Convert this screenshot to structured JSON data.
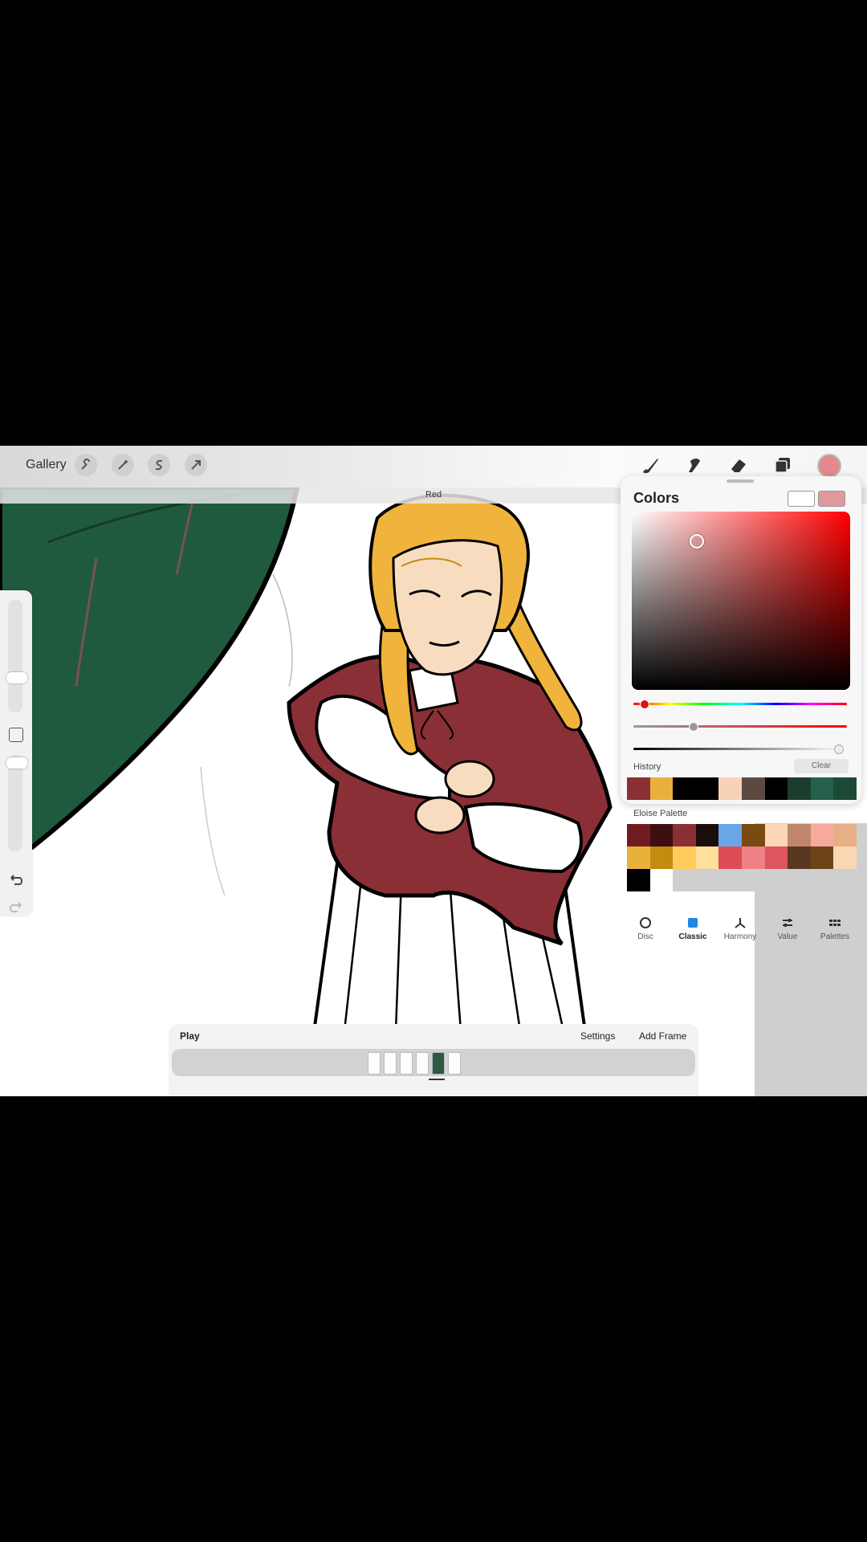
{
  "toolbar": {
    "gallery_label": "Gallery",
    "left_tools": [
      "wrench-icon",
      "magic-wand-icon",
      "selection-icon",
      "transform-arrow-icon"
    ],
    "right_tools": [
      "brush-icon",
      "smudge-icon",
      "eraser-icon",
      "layers-icon"
    ],
    "current_color": "#e28a8e"
  },
  "layer": {
    "name": "Red"
  },
  "colors_panel": {
    "title": "Colors",
    "primary_swatch": "#e0999b",
    "secondary_swatch": "#ffffff",
    "hue_position": 0.05,
    "saturation_position": 0.28,
    "brightness_position": 0.96,
    "history_label": "History",
    "clear_label": "Clear",
    "history_colors": [
      "#8a2f36",
      "#e8b13c",
      "#000000",
      "#000000",
      "#f7d2b8",
      "#5c4a42",
      "#000000",
      "#1b3d2d",
      "#24604a",
      "#1d4a36"
    ],
    "palette_name": "Eloise Palette",
    "palette_colors": [
      "#6e1c22",
      "#3d0f12",
      "#8a2f36",
      "#1a0d0b",
      "#6aa5e8",
      "#7a4a10",
      "#fbd7b7",
      "#c1876a",
      "#f7a99c",
      "#e8ae86",
      "#e8b13c",
      "#c58a10",
      "#ffcc5c",
      "#ffe09a",
      "#dd4c55",
      "#ef8087",
      "#dc5560",
      "#5a3720",
      "#6e4316",
      "#fad7b3",
      "#000000",
      "#ffffff",
      "#cfcfcf",
      "#cfcfcf",
      "#cfcfcf",
      "#cfcfcf",
      "#cfcfcf",
      "#cfcfcf",
      "#cfcfcf",
      "#cfcfcf"
    ],
    "tabs": [
      {
        "label": "Disc",
        "icon": "disc-icon"
      },
      {
        "label": "Classic",
        "icon": "classic-square-icon",
        "active": true
      },
      {
        "label": "Harmony",
        "icon": "harmony-icon"
      },
      {
        "label": "Value",
        "icon": "value-sliders-icon"
      },
      {
        "label": "Palettes",
        "icon": "palettes-grid-icon"
      }
    ]
  },
  "timeline": {
    "play_label": "Play",
    "settings_label": "Settings",
    "add_frame_label": "Add Frame"
  },
  "colors": {
    "cloak": "#8a2f36",
    "hair": "#f0b43c",
    "skin": "#f8dcc0",
    "foliage": "#1f5a3e"
  }
}
